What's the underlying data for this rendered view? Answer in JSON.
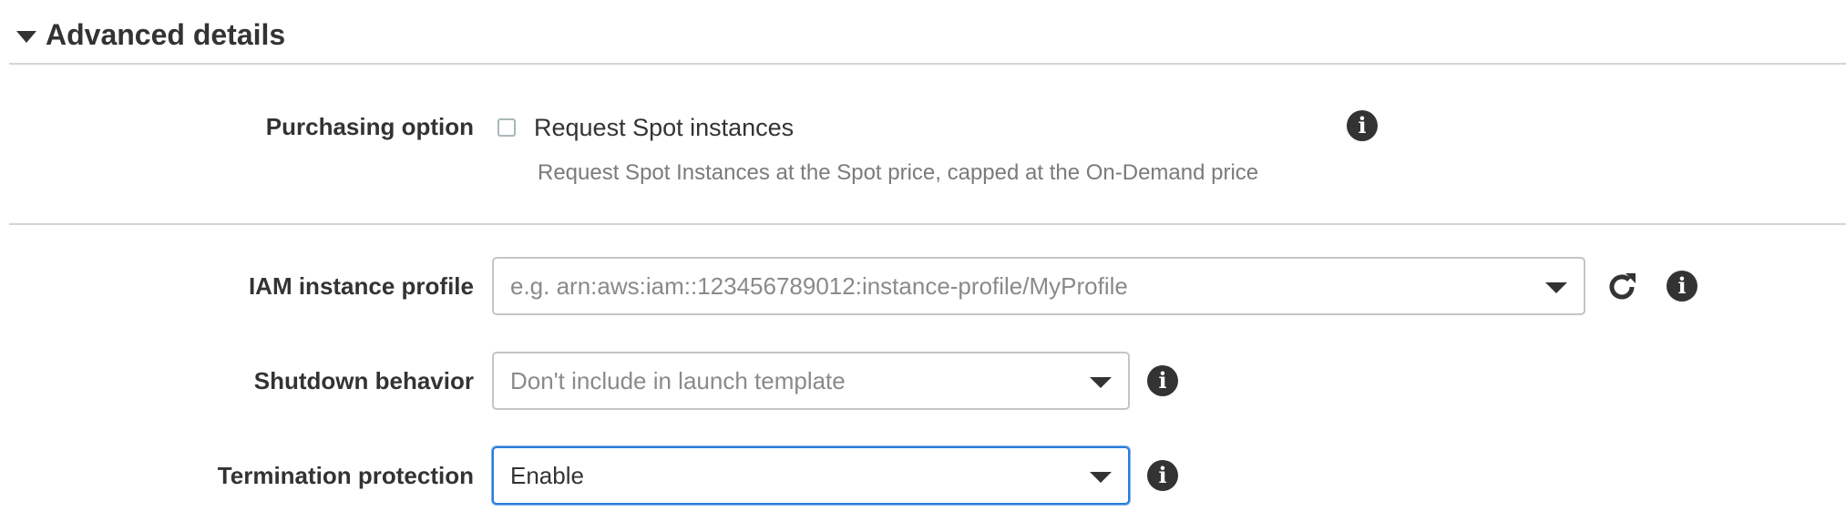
{
  "section": {
    "title": "Advanced details",
    "icon": "caret-down-icon"
  },
  "purchasing_option": {
    "label": "Purchasing option",
    "checkbox_label": "Request Spot instances",
    "checked": false,
    "helper_text": "Request Spot Instances at the Spot price, capped at the On-Demand price"
  },
  "iam_profile": {
    "label": "IAM instance profile",
    "placeholder": "e.g. arn:aws:iam::123456789012:instance-profile/MyProfile"
  },
  "shutdown_behavior": {
    "label": "Shutdown behavior",
    "placeholder": "Don't include in launch template"
  },
  "termination_protection": {
    "label": "Termination protection",
    "value": "Enable"
  },
  "icons": {
    "info": "i",
    "refresh": "refresh-icon"
  },
  "colors": {
    "focus_border": "#2e7dd7",
    "text": "#333333",
    "helper_text": "#7b7b7b",
    "divider": "#d5d5d5"
  }
}
